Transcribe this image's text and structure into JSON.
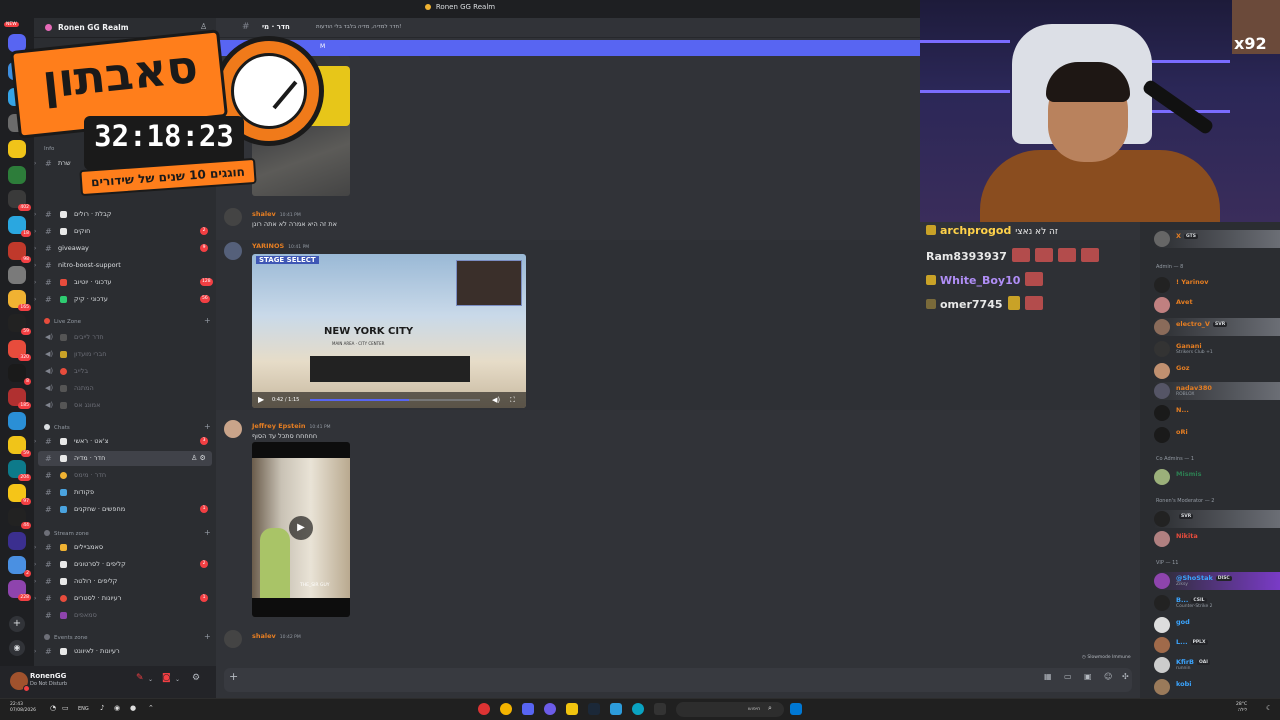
{
  "window": {
    "title": "Ronen GG Realm"
  },
  "server": {
    "name": "Ronen GG Realm"
  },
  "rail": {
    "new_badge": "NEW",
    "badges": [
      "402",
      "18",
      "98",
      "165",
      "59",
      "320",
      "8",
      "185",
      "59",
      "204",
      "97",
      "44",
      "2",
      "228"
    ]
  },
  "sidebar": {
    "channels_top": [
      {
        "label": "Info",
        "type": "cat-small"
      },
      {
        "label": "שרת"
      },
      {
        "label": "קבלת · רולים",
        "badge": ""
      },
      {
        "label": "חוקים",
        "badge": "2"
      },
      {
        "label": "giveaway",
        "badge": "9"
      },
      {
        "label": "nitro-boost-support",
        "badge": ""
      },
      {
        "label": "עדכוני · יוטיוב",
        "badge": "128"
      },
      {
        "label": "עדכוני · קיק",
        "badge": "56"
      }
    ],
    "live_zone": {
      "name": "Live Zone",
      "channels": [
        "חדר לייבים",
        "חברי מועדון",
        "בלייב",
        "המתנה",
        "אמונג אס"
      ]
    },
    "chats": {
      "name": "Chats",
      "channels": [
        {
          "label": "צ'אט · ראשי",
          "badge": "3"
        },
        {
          "label": "חדר · מדיה",
          "badge": ""
        },
        {
          "label": "חדר · מימס",
          "badge": ""
        },
        {
          "label": "פקודות",
          "badge": ""
        },
        {
          "label": "מחפשים · שחקנים",
          "badge": "1"
        }
      ]
    },
    "stream_zone": {
      "name": "Stream zone",
      "channels": [
        {
          "label": "סאמביילים",
          "badge": ""
        },
        {
          "label": "קליפים · לסרטונים",
          "badge": "2"
        },
        {
          "label": "קליפים · רולטה",
          "badge": ""
        },
        {
          "label": "רעיונות · לסטרים",
          "badge": "1"
        },
        {
          "label": "סמאפים",
          "badge": ""
        }
      ]
    },
    "events_zone": {
      "name": "Events zone",
      "channels": [
        {
          "label": "רעיונות · לאיוונט",
          "badge": ""
        }
      ]
    }
  },
  "user": {
    "name": "RonenGG",
    "status": "Do Not Disturb"
  },
  "header": {
    "channel": "חדר · מי",
    "topic": "חדר למדיה, מדיה בלבד בלי הודעות!",
    "banner_text": "M"
  },
  "overlay": {
    "title": "סאבתון",
    "timer": "32:18:23",
    "subtitle": "חוגגים 10 שנים של שידורים"
  },
  "messages": [
    {
      "author": "shalev",
      "time": "10:41 PM",
      "text": "את זה היא אמרה לא אתה רונן",
      "color": "#e67e22"
    },
    {
      "author": "YARINOS",
      "time": "10:41 PM",
      "text": "",
      "color": "#e67e22"
    },
    {
      "author": "Jeffrey Epstein",
      "time": "10:41 PM",
      "text": "חחחחח סתכל עד הסוף",
      "color": "#e67e22"
    },
    {
      "author": "shalev",
      "time": "10:42 PM",
      "text": "",
      "color": "#e67e22"
    }
  ],
  "video1": {
    "stage_label": "STAGE SELECT",
    "city": "NEW YORK CITY",
    "city_sub": "MAIN AREA · CITY CENTER",
    "time": "0:42 / 1:15",
    "progress": 0.58
  },
  "video2": {
    "watermark": "THE_SIR GUY"
  },
  "slowmode": "Slowmode Immune",
  "webcam": {
    "pip_text": "x92"
  },
  "twitch_chat": [
    {
      "user": "archprogod",
      "text": "זה לא נאצי",
      "color": "#ffd24a"
    },
    {
      "user": "Ram8393937",
      "text": "",
      "color": "#e8e8e8"
    },
    {
      "user": "White_Boy10",
      "text": "",
      "color": "#b08ef6"
    },
    {
      "user": "omer7745",
      "text": "",
      "color": "#e8e8e8"
    }
  ],
  "members": {
    "top": {
      "name": "X",
      "tag": "GTS"
    },
    "admin_header": "Admin — 8",
    "admin": [
      {
        "name": "! Yarinov",
        "tag": "",
        "sub": "",
        "color": "#e67e22"
      },
      {
        "name": "Avet",
        "tag": "",
        "sub": "",
        "color": "#e67e22"
      },
      {
        "name": "electro_V",
        "tag": "SVR",
        "sub": "",
        "color": "#e67e22"
      },
      {
        "name": "Ganani",
        "tag": "",
        "sub": "Strikers Club +1",
        "color": "#e67e22"
      },
      {
        "name": "Goz",
        "tag": "",
        "sub": "",
        "color": "#e67e22"
      },
      {
        "name": "nadav380",
        "tag": "",
        "sub": "ROBLOX",
        "color": "#e67e22"
      },
      {
        "name": "N...",
        "tag": "",
        "sub": "",
        "color": "#e67e22"
      },
      {
        "name": "oRi",
        "tag": "",
        "sub": "",
        "color": "#e67e22"
      }
    ],
    "coadmin_header": "Co Admins — 1",
    "coadmin": [
      {
        "name": "Mismis",
        "color": "#2ecc71"
      }
    ],
    "mod_header": "Ronen's Moderator — 2",
    "mods": [
      {
        "name": "",
        "tag": "SVR",
        "color": "#e74c3c"
      },
      {
        "name": "Nikita",
        "tag": "",
        "color": "#e74c3c"
      }
    ],
    "vip_header": "VIP — 11",
    "vip": [
      {
        "name": "@ShoStak",
        "tag": "DISC",
        "sub": "Ziksy",
        "color": "#3ba5ff"
      },
      {
        "name": "B...",
        "tag": "CSIL",
        "sub": "Counter-Strike 2",
        "color": "#3ba5ff"
      },
      {
        "name": "god",
        "tag": "",
        "sub": "",
        "color": "#3ba5ff"
      },
      {
        "name": "L...",
        "tag": "PPLX",
        "sub": "",
        "color": "#3ba5ff"
      },
      {
        "name": "KfirB",
        "tag": "OAI",
        "sub": "runnin",
        "color": "#3ba5ff"
      },
      {
        "name": "kobi",
        "tag": "",
        "sub": "",
        "color": "#3ba5ff"
      }
    ]
  },
  "taskbar": {
    "time": "22:43",
    "date": "07/08/2026",
    "lang": "ENG",
    "search_placeholder": "חיפוש",
    "weather_temp": "28°C",
    "weather_desc": "לילה"
  }
}
